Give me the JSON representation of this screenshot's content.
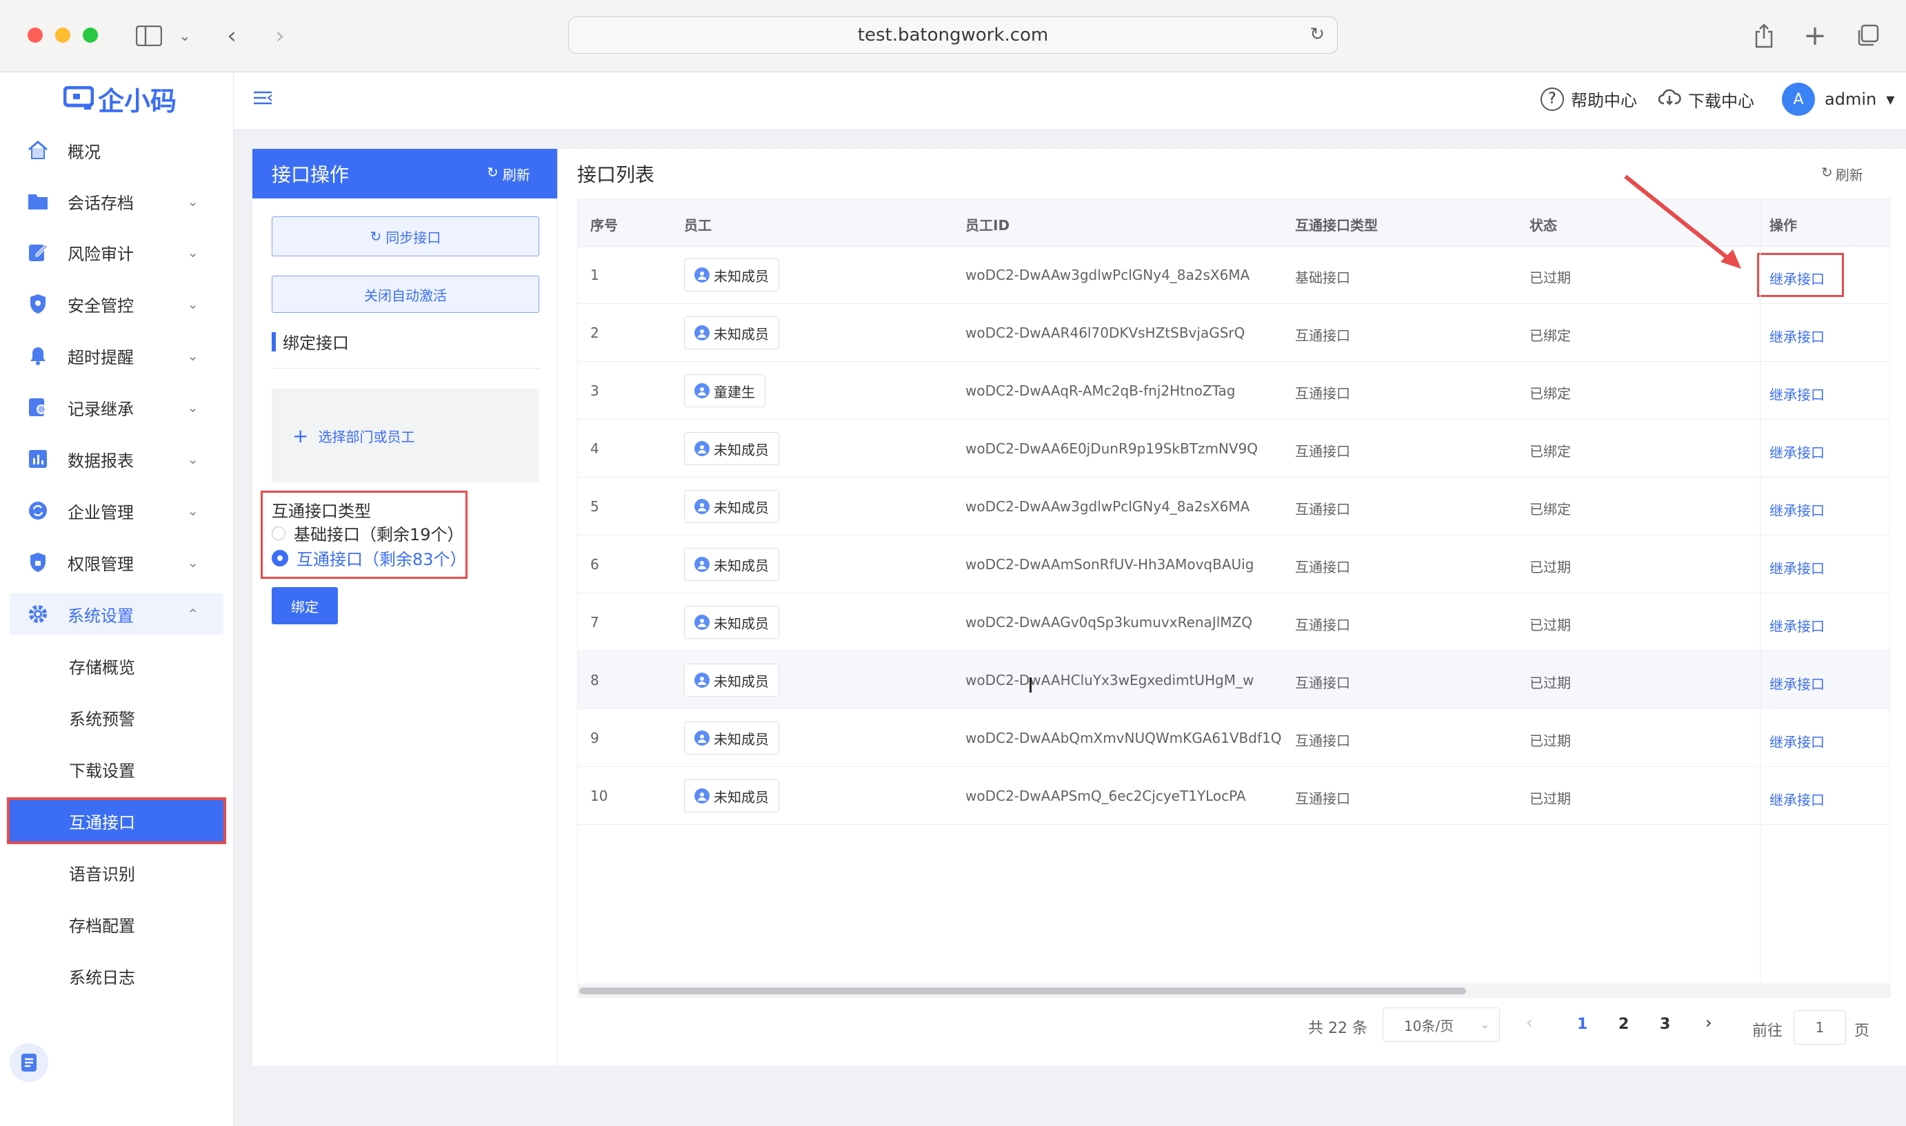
{
  "browser": {
    "url": "test.batongwork.com"
  },
  "app": {
    "logo_text": "企小码"
  },
  "sidebar": {
    "items": [
      {
        "label": "概况",
        "icon": "home-icon"
      },
      {
        "label": "会话存档",
        "icon": "folder-icon"
      },
      {
        "label": "风险审计",
        "icon": "edit-icon"
      },
      {
        "label": "安全管控",
        "icon": "shield-icon"
      },
      {
        "label": "超时提醒",
        "icon": "bell-icon"
      },
      {
        "label": "记录继承",
        "icon": "record-icon"
      },
      {
        "label": "数据报表",
        "icon": "chart-icon"
      },
      {
        "label": "企业管理",
        "icon": "sync-icon"
      },
      {
        "label": "权限管理",
        "icon": "lock-shield-icon"
      },
      {
        "label": "系统设置",
        "icon": "gear-icon"
      }
    ],
    "sub_items": [
      "存储概览",
      "系统预警",
      "下载设置",
      "互通接口",
      "语音识别",
      "存档配置",
      "系统日志"
    ],
    "active_sub": "互通接口"
  },
  "header": {
    "help": "帮助中心",
    "download": "下载中心",
    "user": "admin",
    "avatar_letter": "A"
  },
  "left_panel": {
    "title": "接口操作",
    "refresh": "刷新",
    "sync_btn": "同步接口",
    "auto_btn": "关闭自动激活",
    "section": "绑定接口",
    "select_placeholder": "选择部门或员工",
    "type_label": "互通接口类型",
    "options": [
      "基础接口（剩余19个）",
      "互通接口（剩余83个）"
    ],
    "selected_option": 1,
    "bind_btn": "绑定"
  },
  "table": {
    "title": "接口列表",
    "refresh": "刷新",
    "columns": [
      "序号",
      "员工",
      "员工ID",
      "互通接口类型",
      "状态",
      "操作"
    ],
    "rows": [
      {
        "no": "1",
        "emp": "未知成员",
        "id": "woDC2-DwAAw3gdlwPclGNy4_8a2sX6MA",
        "type": "基础接口",
        "status": "已过期",
        "action": "继承接口"
      },
      {
        "no": "2",
        "emp": "未知成员",
        "id": "woDC2-DwAAR46l70DKVsHZtSBvjaGSrQ",
        "type": "互通接口",
        "status": "已绑定",
        "action": "继承接口"
      },
      {
        "no": "3",
        "emp": "童建生",
        "id": "woDC2-DwAAqR-AMc2qB-fnj2HtnoZTag",
        "type": "互通接口",
        "status": "已绑定",
        "action": "继承接口"
      },
      {
        "no": "4",
        "emp": "未知成员",
        "id": "woDC2-DwAA6E0jDunR9p19SkBTzmNV9Q",
        "type": "互通接口",
        "status": "已绑定",
        "action": "继承接口"
      },
      {
        "no": "5",
        "emp": "未知成员",
        "id": "woDC2-DwAAw3gdlwPclGNy4_8a2sX6MA",
        "type": "互通接口",
        "status": "已绑定",
        "action": "继承接口"
      },
      {
        "no": "6",
        "emp": "未知成员",
        "id": "woDC2-DwAAmSonRfUV-Hh3AMovqBAUig",
        "type": "互通接口",
        "status": "已过期",
        "action": "继承接口"
      },
      {
        "no": "7",
        "emp": "未知成员",
        "id": "woDC2-DwAAGv0qSp3kumuvxRenaJlMZQ",
        "type": "互通接口",
        "status": "已过期",
        "action": "继承接口"
      },
      {
        "no": "8",
        "emp": "未知成员",
        "id": "woDC2-DwAAHCluYx3wEgxedimtUHgM_w",
        "type": "互通接口",
        "status": "已过期",
        "action": "继承接口"
      },
      {
        "no": "9",
        "emp": "未知成员",
        "id": "woDC2-DwAAbQmXmvNUQWmKGA61VBdf1Q",
        "type": "互通接口",
        "status": "已过期",
        "action": "继承接口"
      },
      {
        "no": "10",
        "emp": "未知成员",
        "id": "woDC2-DwAAPSmQ_6ec2CjcyeT1YLocPA",
        "type": "互通接口",
        "status": "已过期",
        "action": "继承接口"
      }
    ]
  },
  "pagination": {
    "total": "共 22 条",
    "page_size": "10条/页",
    "pages": [
      "1",
      "2",
      "3"
    ],
    "current": "1",
    "goto_label": "前往",
    "goto_value": "1",
    "page_unit": "页"
  },
  "colors": {
    "accent": "#3b6ef5",
    "highlight": "#e84b4b"
  }
}
